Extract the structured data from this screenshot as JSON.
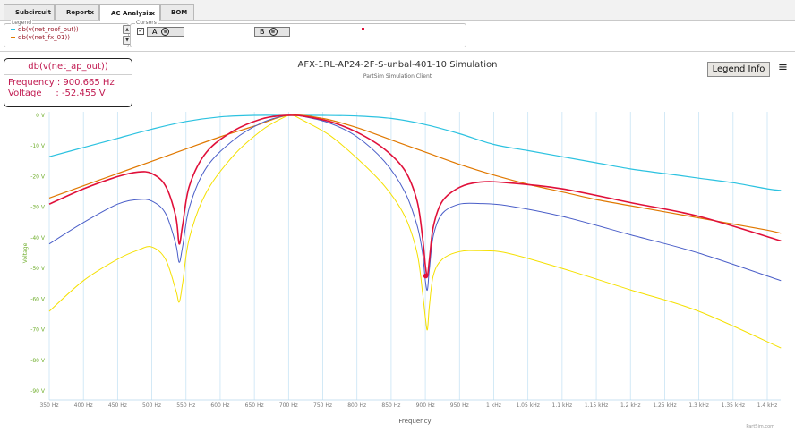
{
  "tabs": [
    {
      "label": "Subcircuit",
      "closable": false
    },
    {
      "label": "Report",
      "closable": true
    },
    {
      "label": "AC Analysis",
      "closable": true,
      "active": true
    },
    {
      "label": "BOM",
      "closable": false
    }
  ],
  "close_glyph": "x",
  "legend_panel": {
    "title": "Legend",
    "items": [
      {
        "label": "db(v(net_roof_out))",
        "color": "#2cc2e0"
      },
      {
        "label": "db(v(net_fx_01))",
        "color": "#e07800"
      }
    ],
    "scroll_up": "▲",
    "scroll_down": "▼"
  },
  "cursor_panel": {
    "title": "Cursors",
    "checkbox_mark": "✓",
    "cursor_a_label": "A",
    "cursor_b_label": "B",
    "remove_glyph": "⊗"
  },
  "readout": {
    "signal": "db(v(net_ap_out))",
    "freq_line": "Frequency : 900.665 Hz",
    "volt_line": "Voltage     : -52.455 V"
  },
  "legend_info_button": "Legend Info",
  "menu_glyph": "≡",
  "footer": "PartSim.com",
  "chart_data": {
    "type": "line",
    "title": "AFX-1RL-AP24-2F-S-unbal-401-10 Simulation",
    "subtitle": "PartSim Simulation Client",
    "xlabel": "Frequency",
    "ylabel": "Voltage",
    "xlim": [
      350,
      1420
    ],
    "ylim": [
      -92,
      2
    ],
    "grid": "vertical",
    "x_ticks": [
      350,
      400,
      450,
      500,
      550,
      600,
      650,
      700,
      750,
      800,
      850,
      900,
      950,
      1000,
      1050,
      1100,
      1150,
      1200,
      1250,
      1300,
      1350,
      1400
    ],
    "x_tick_labels": [
      "350 Hz",
      "400 Hz",
      "450 Hz",
      "500 Hz",
      "550 Hz",
      "600 Hz",
      "650 Hz",
      "700 Hz",
      "750 Hz",
      "800 Hz",
      "850 Hz",
      "900 Hz",
      "950 Hz",
      "1 kHz",
      "1.05 kHz",
      "1.1 kHz",
      "1.15 kHz",
      "1.2 kHz",
      "1.25 kHz",
      "1.3 kHz",
      "1.35 kHz",
      "1.4 kHz"
    ],
    "y_ticks": [
      0,
      -10,
      -20,
      -30,
      -40,
      -50,
      -60,
      -70,
      -80,
      -90
    ],
    "y_tick_labels": [
      "0 V",
      "-10 V",
      "-20 V",
      "-30 V",
      "-40 V",
      "-50 V",
      "-60 V",
      "-70 V",
      "-80 V",
      "-90 V"
    ],
    "series": [
      {
        "name": "db(v(net_roof_out))",
        "color": "#2cc2e0",
        "width": 1.2,
        "x": [
          350,
          400,
          450,
          500,
          550,
          600,
          650,
          700,
          750,
          800,
          850,
          900,
          950,
          1000,
          1050,
          1100,
          1150,
          1200,
          1250,
          1300,
          1350,
          1400,
          1420
        ],
        "y": [
          -13.5,
          -10.5,
          -7.5,
          -4.5,
          -2,
          -0.5,
          0,
          0,
          0,
          -0.2,
          -1,
          -3,
          -6,
          -9.5,
          -11.5,
          -13.5,
          -15.5,
          -17.5,
          -19,
          -20.5,
          -22,
          -24,
          -24.5
        ]
      },
      {
        "name": "db(v(net_fx_01))",
        "color": "#e07800",
        "width": 1.2,
        "x": [
          350,
          400,
          450,
          500,
          550,
          600,
          650,
          700,
          750,
          800,
          850,
          900,
          950,
          1000,
          1050,
          1100,
          1150,
          1200,
          1250,
          1300,
          1350,
          1400,
          1420
        ],
        "y": [
          -27,
          -23,
          -19,
          -15,
          -11,
          -7,
          -3.5,
          0,
          -1,
          -4,
          -8,
          -12,
          -16,
          -19.5,
          -22.5,
          -25,
          -27.5,
          -29.5,
          -31.5,
          -33.5,
          -35.5,
          -37.5,
          -38.5
        ]
      },
      {
        "color": "#4a5ec8",
        "width": 1.0,
        "x": [
          350,
          400,
          450,
          480,
          500,
          520,
          535,
          540,
          545,
          555,
          580,
          620,
          660,
          690,
          705,
          720,
          760,
          800,
          840,
          870,
          888,
          896,
          900,
          903,
          906,
          912,
          925,
          950,
          980,
          1020,
          1100,
          1200,
          1300,
          1420
        ],
        "y": [
          -42,
          -35,
          -29,
          -27.5,
          -28,
          -32,
          -42,
          -48,
          -43,
          -30,
          -17,
          -8,
          -2.5,
          -0.3,
          0,
          -0.3,
          -2.5,
          -7,
          -15,
          -25,
          -36,
          -45,
          -54,
          -57,
          -50,
          -39,
          -32,
          -29,
          -28.8,
          -29.5,
          -33,
          -39,
          -45,
          -54
        ]
      },
      {
        "color": "#f5e000",
        "width": 1.0,
        "x": [
          350,
          400,
          450,
          480,
          500,
          520,
          535,
          540,
          545,
          555,
          580,
          620,
          660,
          690,
          705,
          720,
          760,
          800,
          840,
          870,
          888,
          896,
          900,
          903,
          906,
          912,
          925,
          950,
          980,
          1020,
          1100,
          1200,
          1300,
          1420
        ],
        "y": [
          -64,
          -54,
          -47,
          -44,
          -43,
          -47,
          -57,
          -61,
          -55,
          -40,
          -25,
          -13,
          -5,
          -1,
          0,
          -1.5,
          -6.5,
          -14,
          -23,
          -33,
          -45,
          -58,
          -66,
          -70,
          -62,
          -52,
          -47,
          -44.5,
          -44.2,
          -45,
          -50,
          -57,
          -64,
          -76
        ]
      },
      {
        "color": "#e0103a",
        "width": 1.6,
        "x": [
          350,
          400,
          450,
          480,
          500,
          520,
          535,
          540,
          545,
          555,
          580,
          620,
          660,
          690,
          705,
          720,
          760,
          800,
          840,
          870,
          888,
          896,
          900,
          903,
          906,
          912,
          925,
          950,
          980,
          1020,
          1100,
          1200,
          1300,
          1420
        ],
        "y": [
          -29,
          -24,
          -20,
          -18.5,
          -19,
          -23,
          -33,
          -42,
          -36,
          -23,
          -12,
          -5,
          -1.2,
          -0.1,
          0,
          -0.2,
          -2,
          -5.5,
          -11,
          -18,
          -28,
          -40,
          -49,
          -52.5,
          -47,
          -36,
          -28,
          -23.5,
          -21.8,
          -22,
          -24,
          -28.5,
          -33,
          -41
        ]
      }
    ],
    "marker": {
      "x": 900.665,
      "y": -52.455,
      "color": "#e0103a"
    }
  }
}
